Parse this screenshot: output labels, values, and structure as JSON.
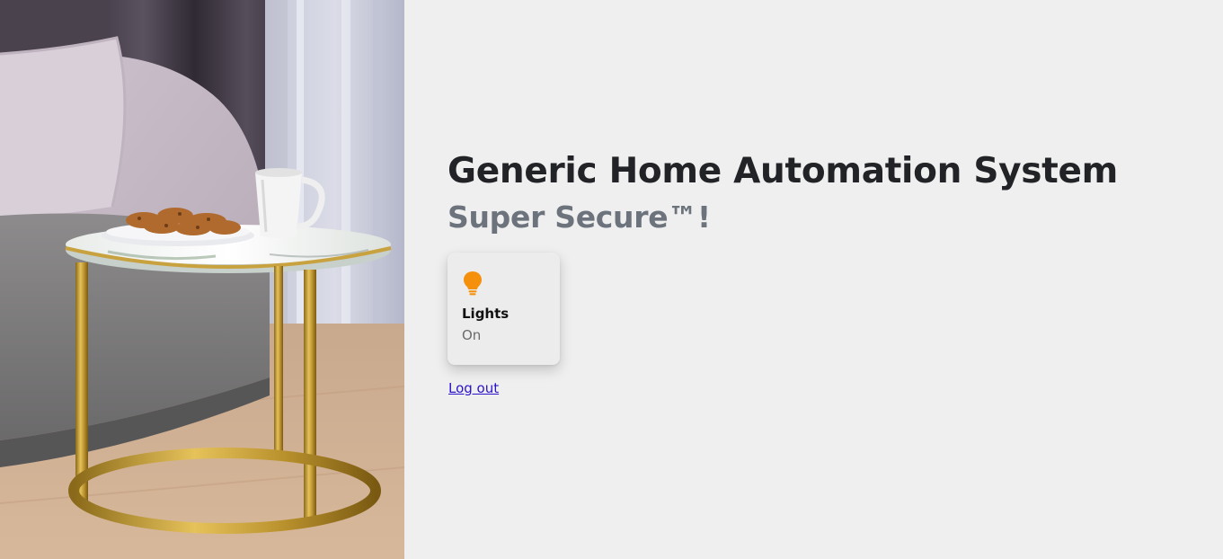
{
  "hero": {
    "image": "living-room-photo"
  },
  "header": {
    "title": "Generic Home Automation System",
    "subtitle": "Super Secure™!"
  },
  "devices": [
    {
      "icon": "lightbulb-icon",
      "icon_color": "#f5900c",
      "label": "Lights",
      "state": "On"
    }
  ],
  "footer": {
    "logout_label": "Log out"
  },
  "colors": {
    "background": "#efefef",
    "title": "#222326",
    "subtitle": "#6c737c",
    "link": "#2a14c9"
  }
}
